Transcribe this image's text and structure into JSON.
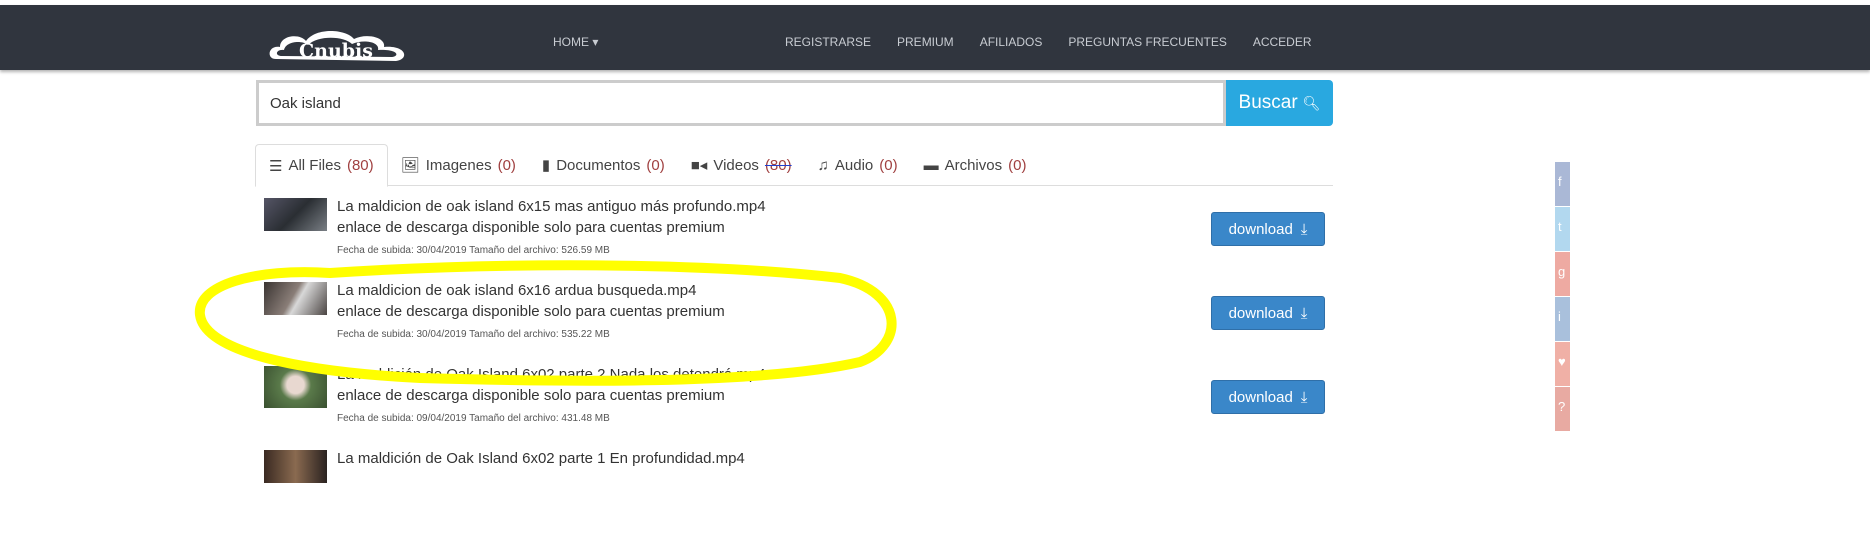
{
  "header": {
    "logo_text": "Cnubis",
    "home_label": "HOME",
    "nav": [
      "REGISTRARSE",
      "PREMIUM",
      "AFILIADOS",
      "PREGUNTAS FRECUENTES",
      "ACCEDER"
    ]
  },
  "search": {
    "value": "Oak island",
    "button_label": "Buscar"
  },
  "tabs": [
    {
      "label": "All Files",
      "count": "(80)"
    },
    {
      "label": "Imagenes",
      "count": "(0)"
    },
    {
      "label": "Documentos",
      "count": "(0)"
    },
    {
      "label": "Videos",
      "count": "(80)"
    },
    {
      "label": "Audio",
      "count": "(0)"
    },
    {
      "label": "Archivos",
      "count": "(0)"
    }
  ],
  "files": [
    {
      "name": "La maldicion de oak island 6x15 mas antiguo más profundo.mp4",
      "note": "enlace de descarga disponible solo para cuentas premium",
      "meta": "Fecha de subida: 30/04/2019  Tamaño del archivo: 526.59 MB",
      "button": "download"
    },
    {
      "name": "La maldicion de oak island 6x16 ardua busqueda.mp4",
      "note": "enlace de descarga disponible solo para cuentas premium",
      "meta": "Fecha de subida: 30/04/2019  Tamaño del archivo: 535.22 MB",
      "button": "download"
    },
    {
      "name": "La maldición de Oak Island 6x02 parte 2 Nada los detendrá.mp4",
      "note": "enlace de descarga disponible solo para cuentas premium",
      "meta": "Fecha de subida: 09/04/2019  Tamaño del archivo: 431.48 MB",
      "button": "download"
    },
    {
      "name": "La maldición de Oak Island 6x02 parte 1 En profundidad.mp4"
    }
  ],
  "social": [
    "facebook-icon",
    "twitter-icon",
    "google-plus-icon",
    "linkedin-icon",
    "pinterest-icon",
    "other-icon"
  ],
  "colors": {
    "navbar": "#30353e",
    "buscar": "#29a8e0",
    "download": "#3a87c9",
    "annotation": "#ffff00"
  }
}
